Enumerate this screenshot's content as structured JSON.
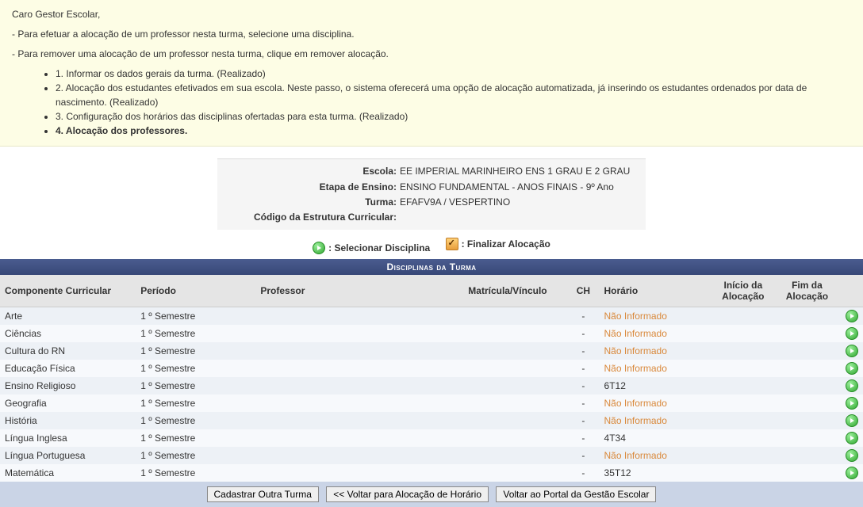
{
  "notice": {
    "greeting": "Caro Gestor Escolar,",
    "line1": "- Para efetuar a alocação de um professor nesta turma, selecione uma disciplina.",
    "line2": "- Para remover uma alocação de um professor nesta turma, clique em remover alocação.",
    "steps": [
      {
        "text": "1. Informar os dados gerais da turma. (Realizado)",
        "bold": false
      },
      {
        "text": "2. Alocação dos estudantes efetivados em sua escola. Neste passo, o sistema oferecerá uma opção de alocação automatizada, já inserindo os estudantes ordenados por data de nascimento. (Realizado)",
        "bold": false
      },
      {
        "text": "3. Configuração dos horários das disciplinas ofertadas para esta turma. (Realizado)",
        "bold": false
      },
      {
        "text": "4. Alocação dos professores.",
        "bold": true
      }
    ]
  },
  "info": {
    "escola_label": "Escola:",
    "escola": "EE IMPERIAL MARINHEIRO ENS 1 GRAU E 2 GRAU",
    "etapa_label": "Etapa de Ensino:",
    "etapa": "ENSINO FUNDAMENTAL - ANOS FINAIS - 9º Ano",
    "turma_label": "Turma:",
    "turma": "EFAFV9A / VESPERTINO",
    "codigo_label": "Código da Estrutura Curricular:",
    "codigo": ""
  },
  "actions": {
    "selecionar": ": Selecionar Disciplina",
    "finalizar": ": Finalizar Alocação"
  },
  "table": {
    "title": "Disciplinas da Turma",
    "headers": {
      "componente": "Componente Curricular",
      "periodo": "Período",
      "professor": "Professor",
      "matricula": "Matrícula/Vínculo",
      "ch": "CH",
      "horario": "Horário",
      "inicio": "Início da Alocação",
      "fim": "Fim da Alocação"
    },
    "rows": [
      {
        "componente": "Arte",
        "periodo": "1 º Semestre",
        "professor": "",
        "matricula": "",
        "ch": "-",
        "horario": "Não Informado",
        "inicio": "",
        "fim": ""
      },
      {
        "componente": "Ciências",
        "periodo": "1 º Semestre",
        "professor": "",
        "matricula": "",
        "ch": "-",
        "horario": "Não Informado",
        "inicio": "",
        "fim": ""
      },
      {
        "componente": "Cultura do RN",
        "periodo": "1 º Semestre",
        "professor": "",
        "matricula": "",
        "ch": "-",
        "horario": "Não Informado",
        "inicio": "",
        "fim": ""
      },
      {
        "componente": "Educação Física",
        "periodo": "1 º Semestre",
        "professor": "",
        "matricula": "",
        "ch": "-",
        "horario": "Não Informado",
        "inicio": "",
        "fim": ""
      },
      {
        "componente": "Ensino Religioso",
        "periodo": "1 º Semestre",
        "professor": "",
        "matricula": "",
        "ch": "-",
        "horario": "6T12",
        "inicio": "",
        "fim": ""
      },
      {
        "componente": "Geografia",
        "periodo": "1 º Semestre",
        "professor": "",
        "matricula": "",
        "ch": "-",
        "horario": "Não Informado",
        "inicio": "",
        "fim": ""
      },
      {
        "componente": "História",
        "periodo": "1 º Semestre",
        "professor": "",
        "matricula": "",
        "ch": "-",
        "horario": "Não Informado",
        "inicio": "",
        "fim": ""
      },
      {
        "componente": "Língua Inglesa",
        "periodo": "1 º Semestre",
        "professor": "",
        "matricula": "",
        "ch": "-",
        "horario": "4T34",
        "inicio": "",
        "fim": ""
      },
      {
        "componente": "Língua Portuguesa",
        "periodo": "1 º Semestre",
        "professor": "",
        "matricula": "",
        "ch": "-",
        "horario": "Não Informado",
        "inicio": "",
        "fim": ""
      },
      {
        "componente": "Matemática",
        "periodo": "1 º Semestre",
        "professor": "",
        "matricula": "",
        "ch": "-",
        "horario": "35T12",
        "inicio": "",
        "fim": ""
      }
    ]
  },
  "footer": {
    "cadastrar": "Cadastrar Outra Turma",
    "voltar_horario": "<< Voltar para Alocação de Horário",
    "voltar_portal": "Voltar ao Portal da Gestão Escolar"
  }
}
